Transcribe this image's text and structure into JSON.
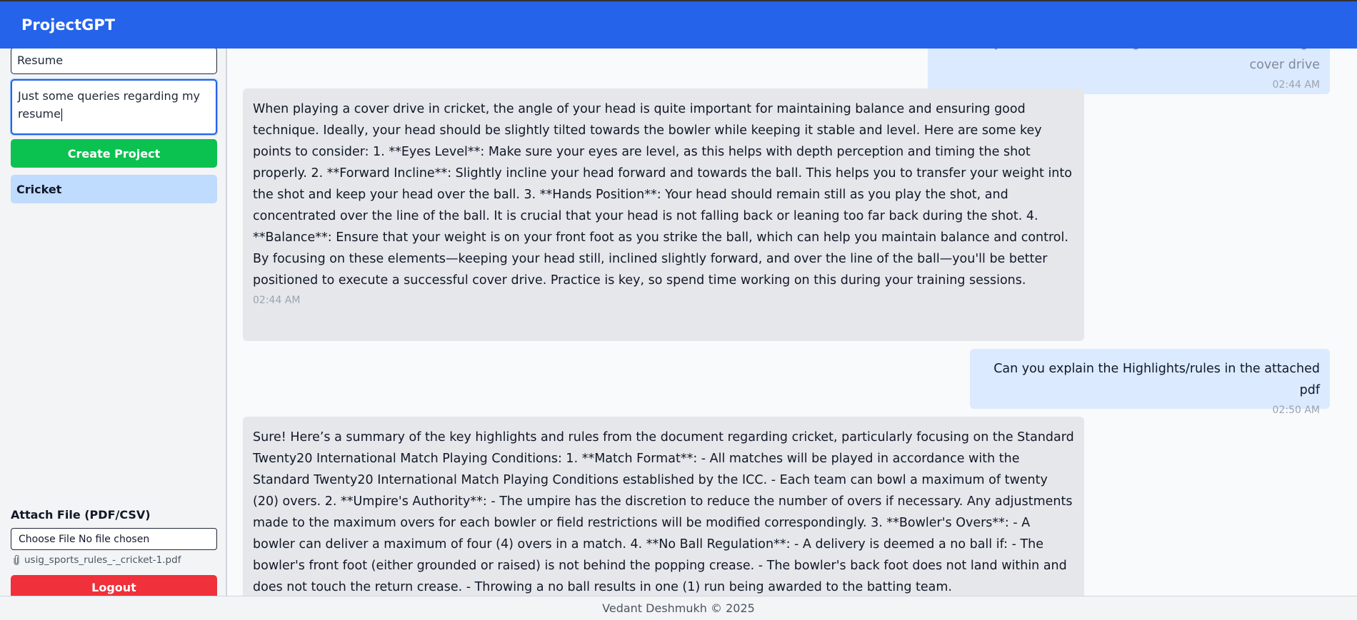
{
  "app": {
    "title": "ProjectGPT"
  },
  "sidebar": {
    "project_name_value": "Resume",
    "project_description_value": "Just some queries regarding my resume",
    "create_button": "Create Project",
    "projects": [
      {
        "label": "Cricket"
      }
    ],
    "attach_label": "Attach File (PDF/CSV)",
    "file_input_text": "Choose File No file chosen",
    "attached_file": "usig_sports_rules_-_cricket-1.pdf",
    "attached_icon": "paperclip-icon",
    "logout_button": "Logout"
  },
  "chat": {
    "messages": [
      {
        "role": "user",
        "text": "Okay, what is the ideal angle of the head while hitting a cover drive",
        "time": "02:44 AM"
      },
      {
        "role": "assistant",
        "text": "When playing a cover drive in cricket, the angle of your head is quite important for maintaining balance and ensuring good technique. Ideally, your head should be slightly tilted towards the bowler while keeping it stable and level. Here are some key points to consider: 1. **Eyes Level**: Make sure your eyes are level, as this helps with depth perception and timing the shot properly. 2. **Forward Incline**: Slightly incline your head forward and towards the ball. This helps you to transfer your weight into the shot and keep your head over the ball. 3. **Hands Position**: Your head should remain still as you play the shot, and concentrated over the line of the ball. It is crucial that your head is not falling back or leaning too far back during the shot. 4. **Balance**: Ensure that your weight is on your front foot as you strike the ball, which can help you maintain balance and control. By focusing on these elements—keeping your head still, inclined slightly forward, and over the line of the ball—you'll be better positioned to execute a successful cover drive. Practice is key, so spend time working on this during your training sessions.",
        "time": "02:44 AM"
      },
      {
        "role": "user",
        "text": "Can you explain the Highlights/rules in the attached pdf",
        "time": "02:50 AM"
      },
      {
        "role": "assistant",
        "text": "Sure! Here’s a summary of the key highlights and rules from the document regarding cricket, particularly focusing on the Standard Twenty20 International Match Playing Conditions: 1. **Match Format**: - All matches will be played in accordance with the Standard Twenty20 International Match Playing Conditions established by the ICC. - Each team can bowl a maximum of twenty (20) overs. 2. **Umpire's Authority**: - The umpire has the discretion to reduce the number of overs if necessary. Any adjustments made to the maximum overs for each bowler or field restrictions will be modified correspondingly. 3. **Bowler's Overs**: - A bowler can deliver a maximum of four (4) overs in a match. 4. **No Ball Regulation**: - A delivery is deemed a no ball if: - The bowler's front foot (either grounded or raised) is not behind the popping crease. - The bowler's back foot does not land within and does not touch the return crease. - Throwing a no ball results in one (1) run being awarded to the batting team.",
        "time": ""
      }
    ]
  },
  "footer": {
    "text": "Vedant Deshmukh © 2025"
  }
}
